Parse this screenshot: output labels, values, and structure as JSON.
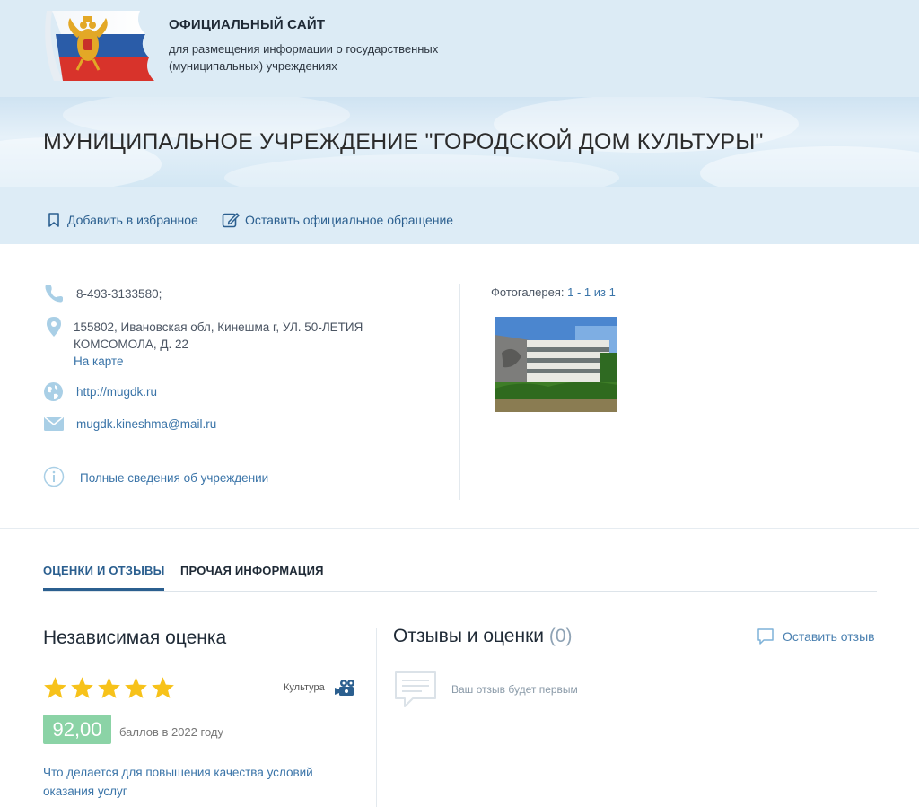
{
  "header": {
    "title": "ОФИЦИАЛЬНЫЙ САЙТ",
    "subtitle": "для размещения информации о государственных (муниципальных) учреждениях"
  },
  "organization": {
    "name": "МУНИЦИПАЛЬНОЕ УЧРЕЖДЕНИЕ \"ГОРОДСКОЙ ДОМ КУЛЬТУРЫ\""
  },
  "actions": {
    "favorite": "Добавить в избранное",
    "appeal": "Оставить официальное обращение"
  },
  "contacts": {
    "phone": "8-493-3133580;",
    "address": "155802, Ивановская обл, Кинешма г, УЛ. 50-ЛЕТИЯ КОМСОМОЛА, Д. 22",
    "map_link": "На карте",
    "website": "http://mugdk.ru",
    "email": "mugdk.kineshma@mail.ru",
    "full_info": "Полные сведения об учреждении"
  },
  "gallery": {
    "label": "Фотогалерея:",
    "count": "1 - 1 из 1"
  },
  "tabs": [
    {
      "label": "ОЦЕНКИ И ОТЗЫВЫ",
      "active": true
    },
    {
      "label": "ПРОЧАЯ ИНФОРМАЦИЯ",
      "active": false
    }
  ],
  "rating": {
    "title": "Независимая оценка",
    "stars": 5,
    "category": "Культура",
    "category_icon": "camera-icon",
    "score": "92,00",
    "score_note": "баллов в 2022 году",
    "quality_link": "Что делается для повышения качества условий оказания услуг"
  },
  "reviews": {
    "title": "Отзывы и оценки",
    "count": "(0)",
    "leave": "Оставить отзыв",
    "empty": "Ваш отзыв будет первым"
  },
  "colors": {
    "header_bg": "#dcebf5",
    "link": "#3a74a8",
    "accent": "#2b5f8f",
    "score_bg": "#8bd3a6",
    "star": "#f7c21a",
    "icon": "#a9cfe6"
  }
}
